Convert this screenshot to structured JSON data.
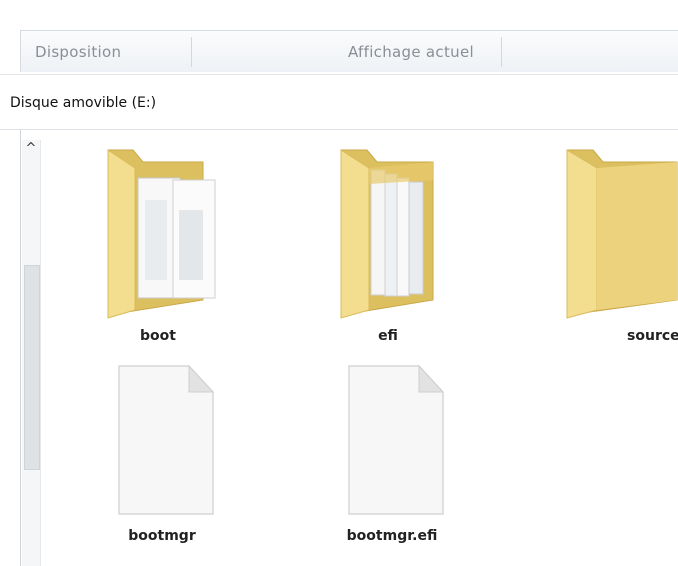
{
  "ribbon": {
    "groups": [
      {
        "label": "Disposition"
      },
      {
        "label": "Affichage actuel"
      }
    ]
  },
  "address": {
    "path": "Disque amovible (E:)"
  },
  "scrollbar": {
    "up_arrow": "^"
  },
  "items": [
    {
      "name": "boot",
      "type": "folder",
      "icon": "folder-with-documents-icon"
    },
    {
      "name": "efi",
      "type": "folder",
      "icon": "folder-with-documents-icon"
    },
    {
      "name": "sources",
      "type": "folder",
      "icon": "folder-icon"
    },
    {
      "name": "bootmgr",
      "type": "file",
      "icon": "file-icon"
    },
    {
      "name": "bootmgr.efi",
      "type": "file",
      "icon": "file-icon"
    }
  ],
  "colors": {
    "folder_light": "#f3dd8e",
    "folder_dark": "#dcbf5f",
    "file_fill": "#f7f7f7"
  }
}
